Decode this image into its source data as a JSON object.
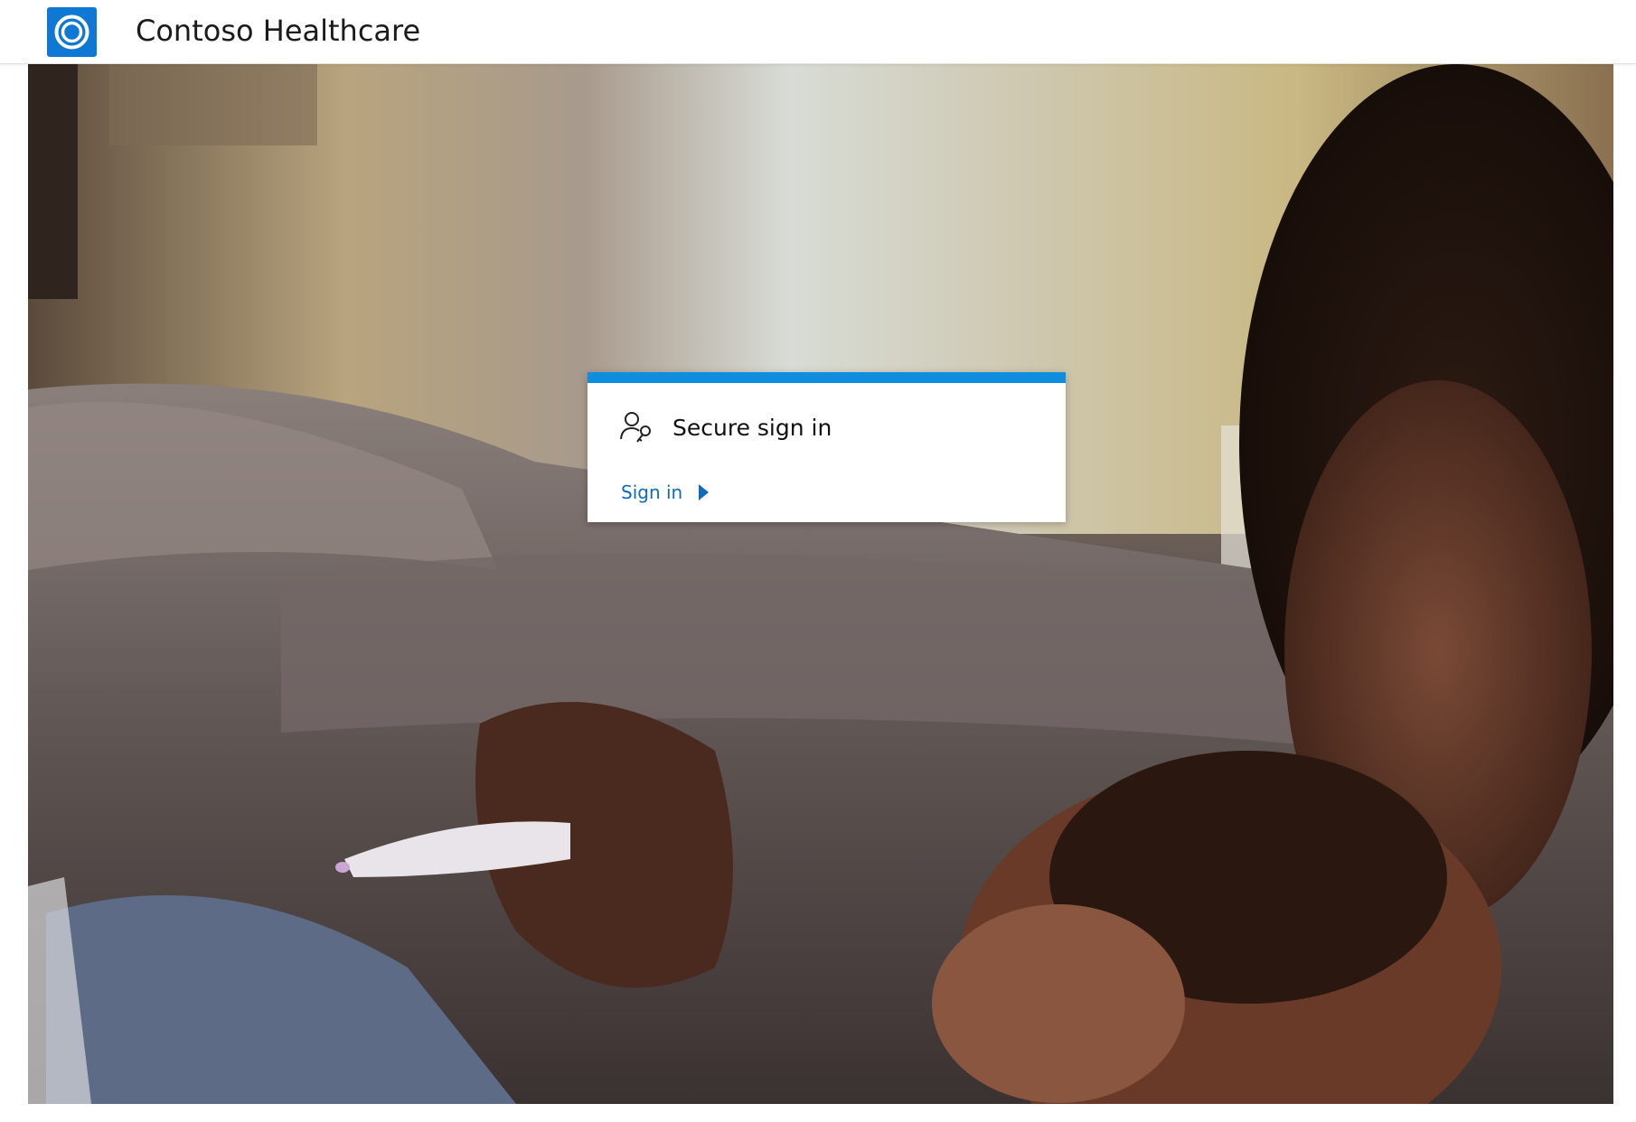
{
  "header": {
    "logo_icon": "contoso-ring-logo-icon",
    "title": "Contoso Healthcare"
  },
  "hero": {
    "image": "parent-and-child-with-thermometer-photo"
  },
  "signin_card": {
    "icon": "user-key-icon",
    "title": "Secure sign in",
    "link_label": "Sign in",
    "link_icon": "caret-right-icon",
    "accent_color": "#0f8ee0",
    "link_color": "#0f6cbd"
  }
}
